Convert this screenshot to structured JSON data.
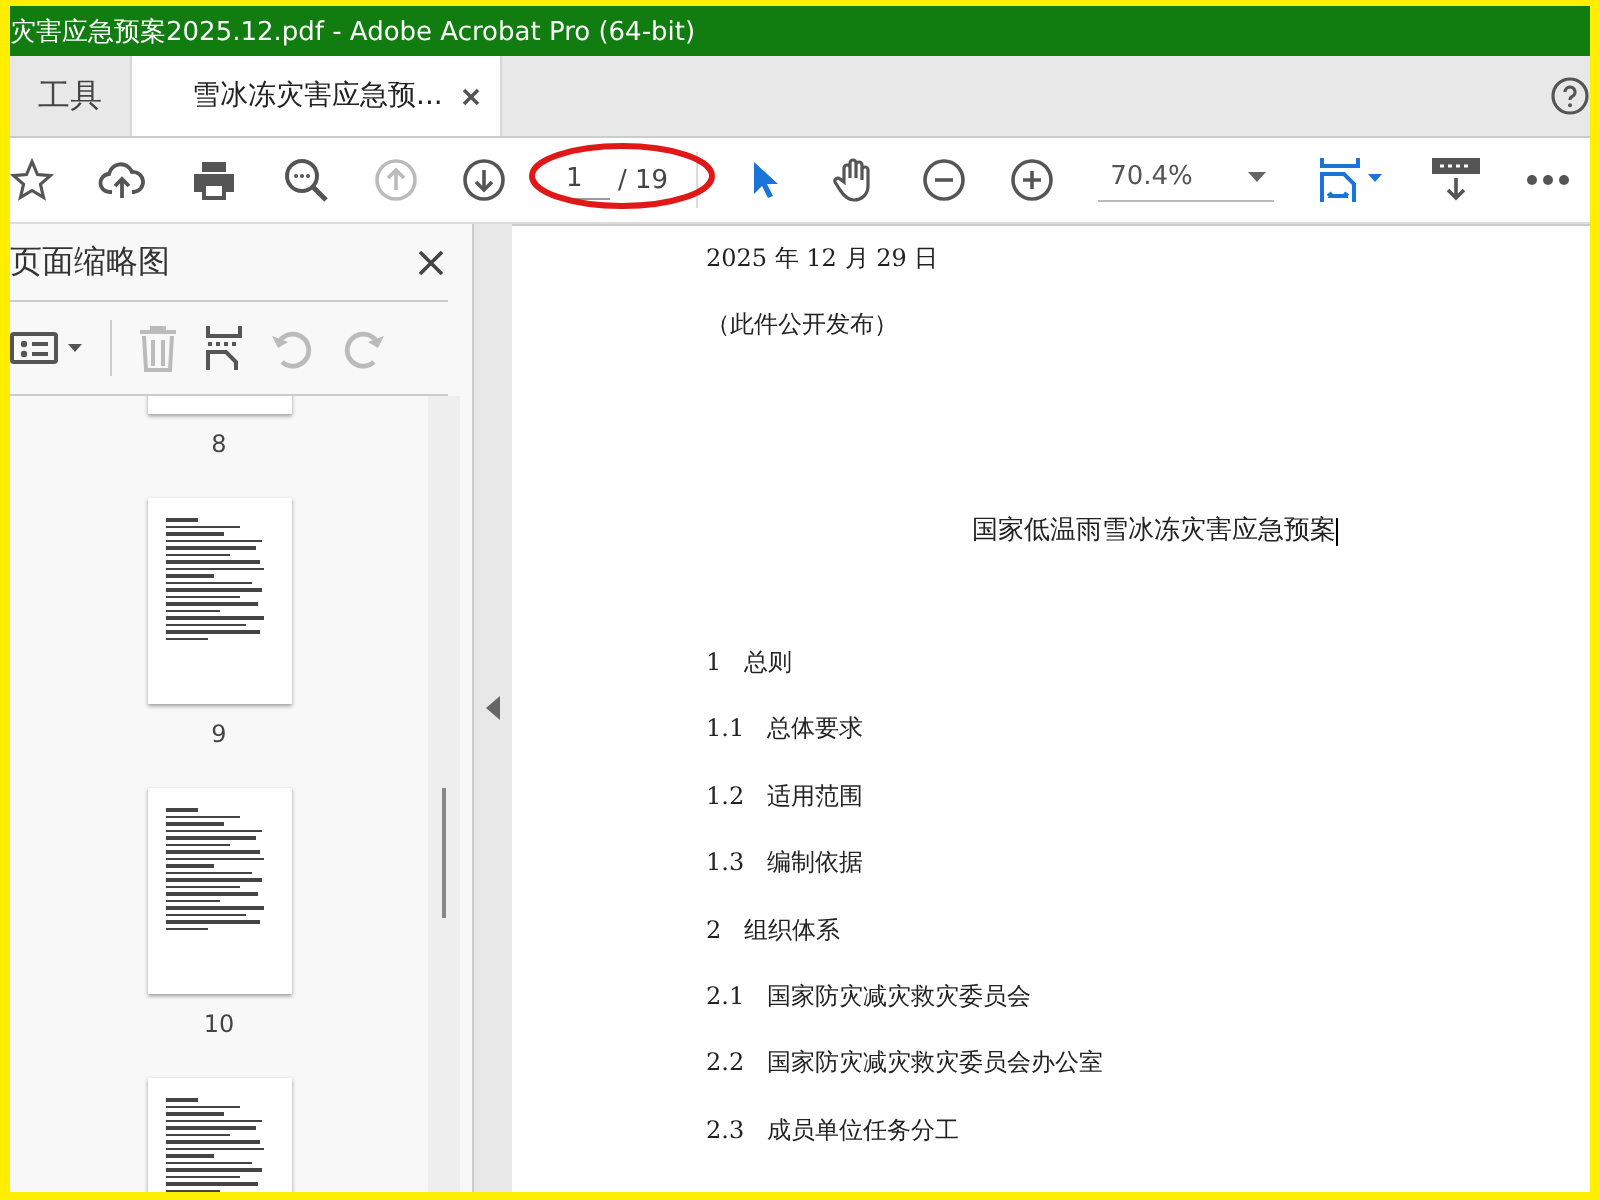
{
  "window": {
    "title": "灾害应急预案2025.12.pdf - Adobe Acrobat Pro (64-bit)"
  },
  "tabs": [
    {
      "label": "工具",
      "selected": false
    },
    {
      "label": "雪冰冻灾害应急预...",
      "selected": true
    }
  ],
  "toolbar": {
    "nav_buttons": [
      {
        "kind": "up",
        "disabled": true
      },
      {
        "kind": "down",
        "disabled": false
      }
    ],
    "page_current": "1",
    "page_total": "/ 19",
    "page_highlighted": true,
    "tools": [
      {
        "kind": "select",
        "selected": true
      },
      {
        "kind": "hand",
        "selected": false
      }
    ],
    "zoom": "70.4%"
  },
  "sidebar": {
    "title": "页面缩略图",
    "thumbnails": [
      {
        "label": "8"
      },
      {
        "label": "9"
      },
      {
        "label": "10"
      }
    ]
  },
  "document": {
    "date": "2025 年 12 月 29 日",
    "note": "（此件公开发布）",
    "title": "国家低温雨雪冰冻灾害应急预案",
    "toc": [
      {
        "number": "1",
        "text": "总则"
      },
      {
        "number": "1.1",
        "text": "总体要求"
      },
      {
        "number": "1.2",
        "text": "适用范围"
      },
      {
        "number": "1.3",
        "text": "编制依据"
      },
      {
        "number": "2",
        "text": "组织体系"
      },
      {
        "number": "2.1",
        "text": "国家防灾减灾救灾委员会"
      },
      {
        "number": "2.2",
        "text": "国家防灾减灾救灾委员会办公室"
      },
      {
        "number": "2.3",
        "text": "成员单位任务分工"
      }
    ]
  }
}
